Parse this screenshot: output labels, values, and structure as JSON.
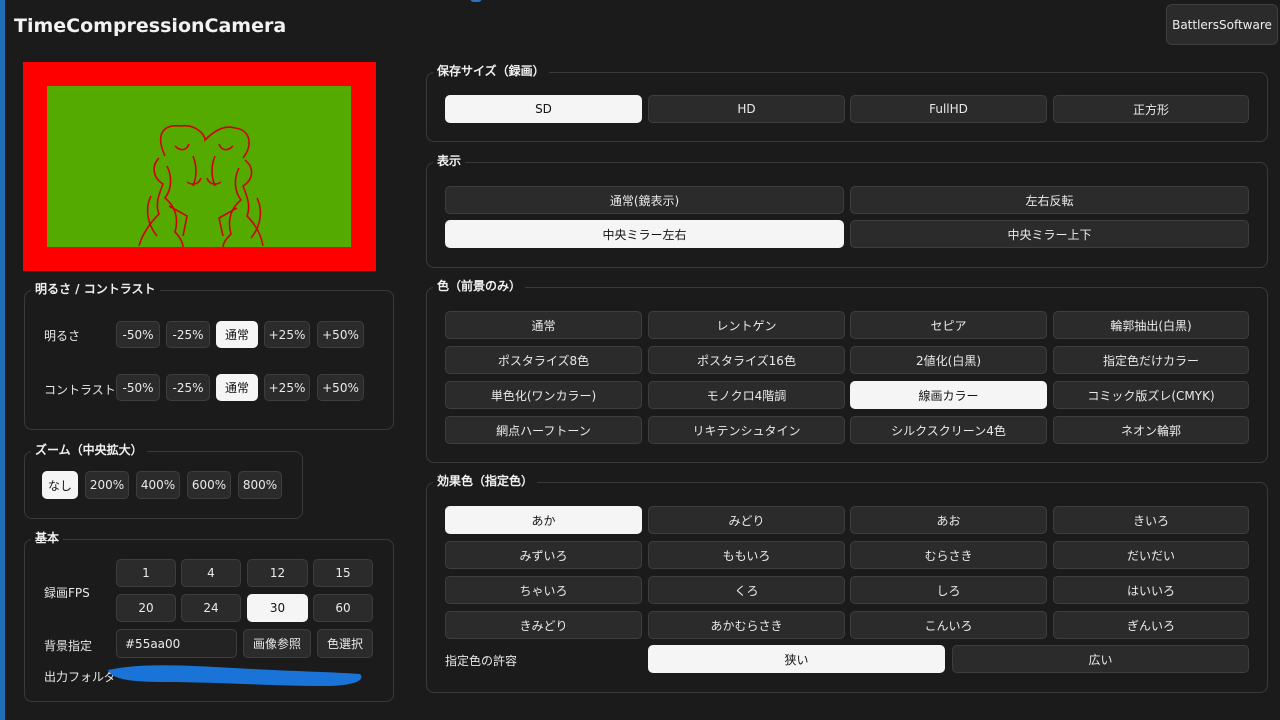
{
  "app": {
    "title": "TimeCompressionCamera",
    "brand_button": "BattlersSoftware"
  },
  "colors": {
    "preview_border": "#ff0000",
    "preview_bg": "#55aa00",
    "outline": "#d10000",
    "accent_redaction": "#1a73d6"
  },
  "brightness_contrast": {
    "title": "明るさ / コントラスト",
    "brightness_label": "明るさ",
    "contrast_label": "コントラスト",
    "options": [
      "-50%",
      "-25%",
      "通常",
      "+25%",
      "+50%"
    ],
    "brightness_selected": "通常",
    "contrast_selected": "通常"
  },
  "zoom": {
    "title": "ズーム（中央拡大）",
    "options": [
      "なし",
      "200%",
      "400%",
      "600%",
      "800%"
    ],
    "selected": "なし"
  },
  "basic": {
    "title": "基本",
    "fps_label": "録画FPS",
    "fps_options": [
      "1",
      "4",
      "12",
      "15",
      "20",
      "24",
      "30",
      "60"
    ],
    "fps_selected": "30",
    "bg_label": "背景指定",
    "bg_value": "#55aa00",
    "image_ref_button": "画像参照",
    "color_select_button": "色選択",
    "output_label": "出力フォルダ"
  },
  "save_size": {
    "title": "保存サイズ（録画）",
    "options": [
      "SD",
      "HD",
      "FullHD",
      "正方形"
    ],
    "selected": "SD"
  },
  "display": {
    "title": "表示",
    "options": [
      "通常(鏡表示)",
      "左右反転",
      "中央ミラー左右",
      "中央ミラー上下"
    ],
    "selected": "中央ミラー左右"
  },
  "color_mode": {
    "title": "色（前景のみ）",
    "options": [
      "通常",
      "レントゲン",
      "セピア",
      "輪郭抽出(白黒)",
      "ポスタライズ8色",
      "ポスタライズ16色",
      "2値化(白黒)",
      "指定色だけカラー",
      "単色化(ワンカラー)",
      "モノクロ4階調",
      "線画カラー",
      "コミック版ズレ(CMYK)",
      "網点ハーフトーン",
      "リキテンシュタイン",
      "シルクスクリーン4色",
      "ネオン輪郭"
    ],
    "selected": "線画カラー"
  },
  "effect_color": {
    "title": "効果色（指定色）",
    "options": [
      "あか",
      "みどり",
      "あお",
      "きいろ",
      "みずいろ",
      "ももいろ",
      "むらさき",
      "だいだい",
      "ちゃいろ",
      "くろ",
      "しろ",
      "はいいろ",
      "きみどり",
      "あかむらさき",
      "こんいろ",
      "ぎんいろ"
    ],
    "selected": "あか",
    "tolerance_label": "指定色の許容",
    "tolerance_options": [
      "狭い",
      "広い"
    ],
    "tolerance_selected": "狭い"
  }
}
